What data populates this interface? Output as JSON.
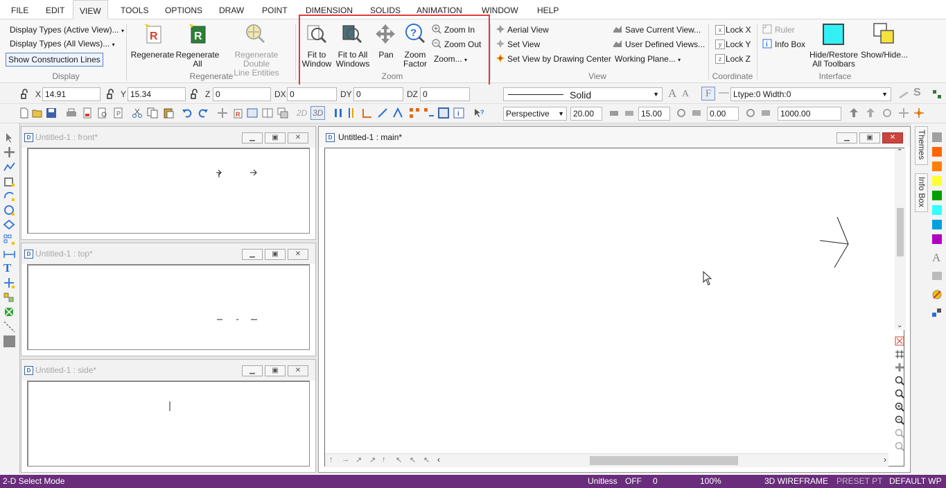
{
  "menu": [
    "FILE",
    "EDIT",
    "VIEW",
    "TOOLS",
    "OPTIONS",
    "DRAW",
    "POINT",
    "DIMENSION",
    "SOLIDS",
    "ANIMATION",
    "WINDOW",
    "HELP"
  ],
  "ribbon": {
    "display": {
      "active_views": "Display Types (Active View)...",
      "all_views": "Display Types (All Views)...",
      "construction": "Show Construction Lines",
      "label": "Display"
    },
    "regenerate": {
      "regen": "Regenerate",
      "regen_all": [
        "Regenerate",
        "All"
      ],
      "regen_double": [
        "Regenerate Double",
        "Line Entities"
      ],
      "label": "Regenerate"
    },
    "zoom": {
      "fit_window": [
        "Fit to",
        "Window"
      ],
      "fit_all": [
        "Fit to All",
        "Windows"
      ],
      "pan": "Pan",
      "factor": [
        "Zoom",
        "Factor"
      ],
      "zoom_in": "Zoom In",
      "zoom_out": "Zoom Out",
      "zoom_menu": "Zoom...",
      "label": "Zoom"
    },
    "view": {
      "aerial": "Aerial View",
      "set_view": "Set View",
      "set_center": "Set View by Drawing Center",
      "save_current": "Save Current View...",
      "user_defined": "User Defined Views...",
      "working_plane": "Working Plane...",
      "label": "View"
    },
    "coordinate": {
      "lock_x": "Lock X",
      "lock_y": "Lock Y",
      "lock_z": "Lock Z",
      "label": "Coordinate"
    },
    "interface": {
      "ruler": "Ruler",
      "info_box": "Info Box",
      "hide_restore": [
        "Hide/Restore",
        "All Toolbars"
      ],
      "show_hide": "Show/Hide...",
      "label": "Interface"
    }
  },
  "coords": {
    "x_label": "X",
    "x_value": "14.91",
    "y_label": "Y",
    "y_value": "15.34",
    "z_label": "Z",
    "z_value": "0",
    "dx_label": "DX",
    "dx_value": "0",
    "dy_label": "DY",
    "dy_value": "0",
    "dz_label": "DZ",
    "dz_value": "0"
  },
  "line": {
    "style": "Solid",
    "ltype": "Ltype:0  Width:0"
  },
  "view_toolbar": {
    "projection": "Perspective",
    "v1": "20.00",
    "v2": "15.00",
    "v3": "0.00",
    "v4": "1000.00",
    "mode_2d": "2D",
    "mode_3d": "3D"
  },
  "windows": {
    "front": "Untitled-1 : front*",
    "top": "Untitled-1 : top*",
    "side": "Untitled-1 : side*",
    "main": "Untitled-1 : main*"
  },
  "side_tabs": {
    "themes": "Themes",
    "info_box": "Info Box"
  },
  "swatches": [
    "#a0a0a0",
    "#ff6600",
    "#ff7f00",
    "#ffff33",
    "#00a000",
    "#33ffff",
    "#00a0e0",
    "#b000c0"
  ],
  "status": {
    "mode": "2-D Select Mode",
    "units": "Unitless",
    "snap": "OFF",
    "value": "0",
    "zoom": "100%",
    "render": "3D WIREFRAME",
    "preset": "PRESET PT",
    "wp": "DEFAULT WP"
  },
  "colors": {
    "status_bar": "#6a2d7b",
    "highlight": "#e03a3a",
    "accent_blue": "#2b6fd6"
  }
}
